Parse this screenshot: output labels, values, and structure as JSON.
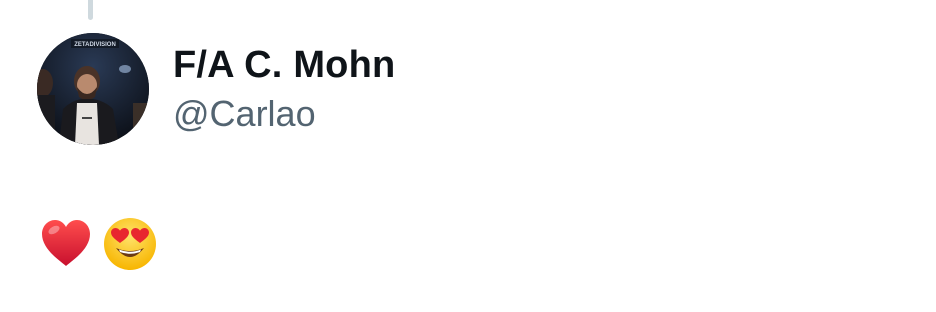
{
  "tweet": {
    "author": {
      "display_name": "F/A C. Mohn",
      "handle": "@Carlao",
      "avatar_banner_text": "ZETADIVISION"
    },
    "body": {
      "emojis": [
        "red-heart",
        "smiling-face-with-heart-eyes"
      ]
    }
  },
  "colors": {
    "name": "#0f1419",
    "handle": "#536471",
    "thread_line": "#cfd9de",
    "background": "#ffffff"
  }
}
